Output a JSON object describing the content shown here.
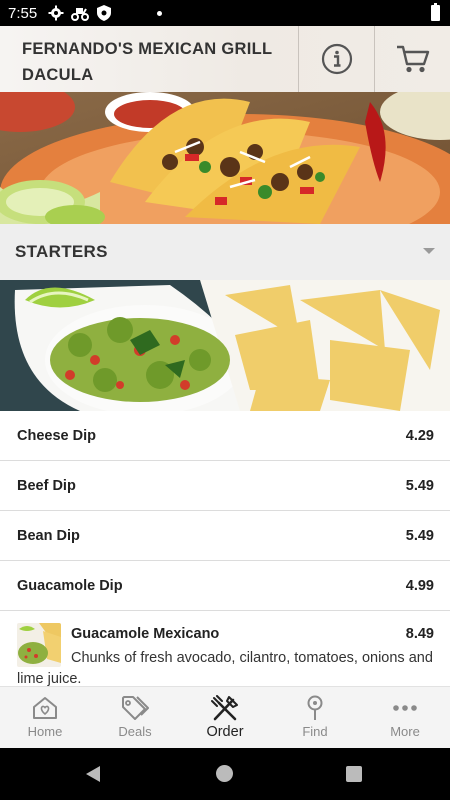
{
  "status_bar": {
    "time": "7:55"
  },
  "header": {
    "title_line1": "FERNANDO'S MEXICAN GRILL",
    "title_line2": "DACULA",
    "icons": [
      "info-icon",
      "cart-icon"
    ]
  },
  "section": {
    "title": "STARTERS"
  },
  "menu_items": [
    {
      "name": "Cheese Dip",
      "price": "4.29"
    },
    {
      "name": "Beef Dip",
      "price": "5.49"
    },
    {
      "name": "Bean Dip",
      "price": "5.49"
    },
    {
      "name": "Guacamole Dip",
      "price": "4.99"
    },
    {
      "name": "Guacamole Mexicano",
      "price": "8.49",
      "description": "Chunks of fresh avocado, cilantro, tomatoes, onions and lime juice."
    }
  ],
  "bottom_nav": [
    {
      "label": "Home",
      "icon": "home-icon"
    },
    {
      "label": "Deals",
      "icon": "tag-icon"
    },
    {
      "label": "Order",
      "icon": "utensils-icon",
      "active": true
    },
    {
      "label": "Find",
      "icon": "pin-icon"
    },
    {
      "label": "More",
      "icon": "more-icon"
    }
  ]
}
